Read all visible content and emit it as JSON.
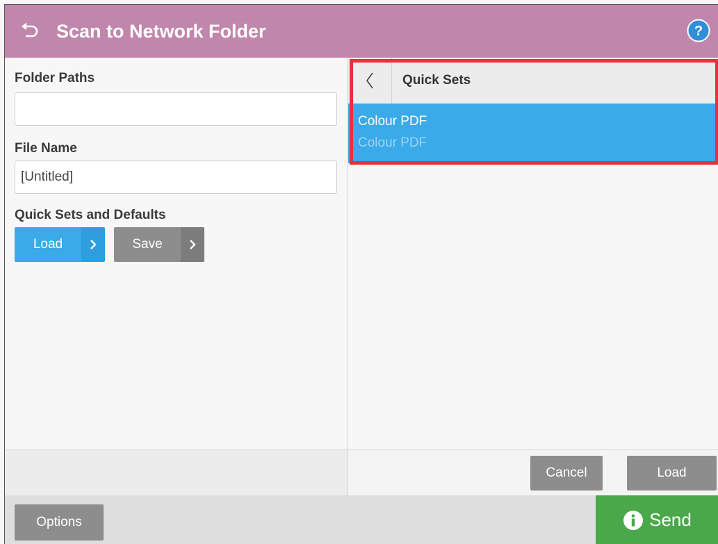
{
  "header": {
    "title": "Scan to Network Folder",
    "back_icon": "back-arrow-icon",
    "help_icon": "help-icon",
    "bar_color": "#c186ab"
  },
  "form": {
    "folder_paths_label": "Folder Paths",
    "folder_paths_value": "",
    "file_name_label": "File Name",
    "file_name_value": "[Untitled]",
    "quick_sets_label": "Quick Sets and Defaults",
    "load_button": "Load",
    "save_button": "Save"
  },
  "quick_sets_panel": {
    "title": "Quick Sets",
    "items": [
      {
        "name": "Colour PDF",
        "description": "Colour PDF",
        "selected": true
      }
    ],
    "cancel_button": "Cancel",
    "load_button": "Load",
    "accent_color": "#3aaae8",
    "highlight_color": "#e8303e"
  },
  "bottom": {
    "options_button": "Options",
    "send_button": "Send",
    "send_color": "#4aa84a"
  }
}
